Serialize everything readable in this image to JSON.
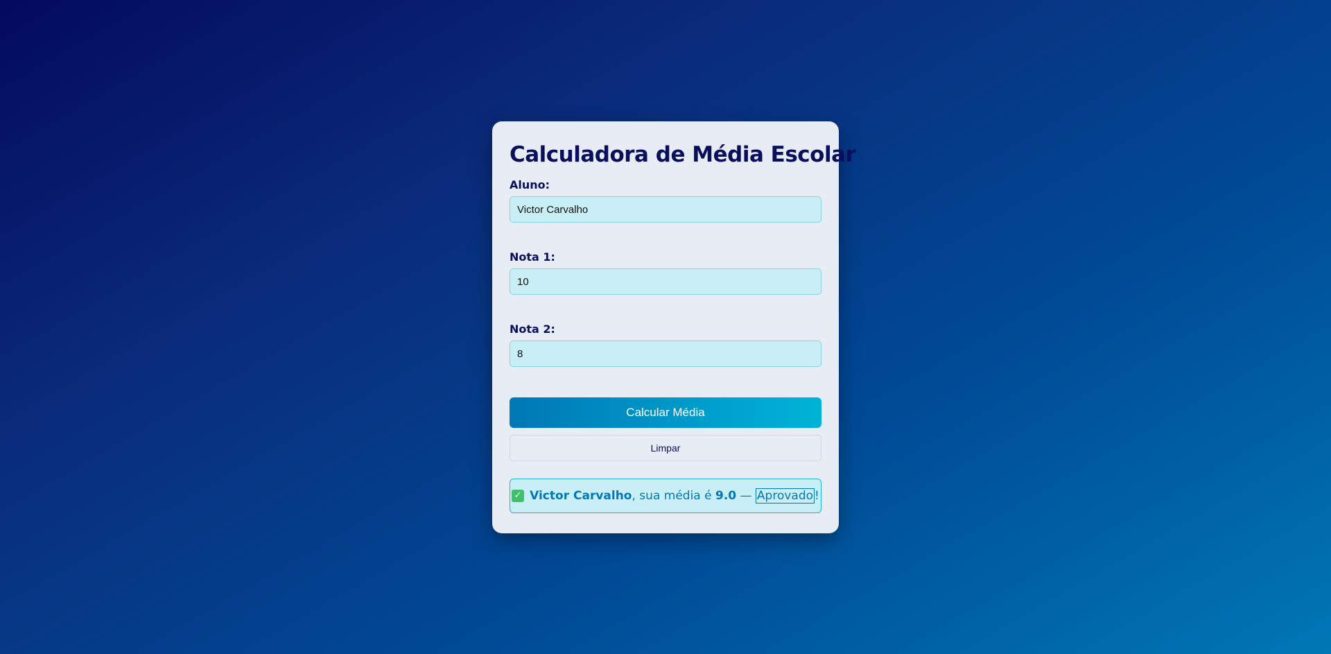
{
  "title": "Calculadora de Média Escolar",
  "form": {
    "aluno_label": "Aluno:",
    "aluno_value": "Victor Carvalho",
    "nota1_label": "Nota 1:",
    "nota1_value": "10",
    "nota2_label": "Nota 2:",
    "nota2_value": "8"
  },
  "buttons": {
    "calculate": "Calcular Média",
    "clear": "Limpar"
  },
  "result": {
    "icon": "check-icon",
    "icon_color": "#3fc06a",
    "name": "Victor Carvalho",
    "text_middle": ", sua média é ",
    "average": "9.0",
    "separator": " — ",
    "status": "Aprovado",
    "suffix": "!"
  },
  "colors": {
    "title": "#0a0f5c",
    "accent": "#0077b6",
    "accent_light": "#00b4d8",
    "input_bg": "#c8eff6",
    "card_bg": "#e7ecf5"
  }
}
